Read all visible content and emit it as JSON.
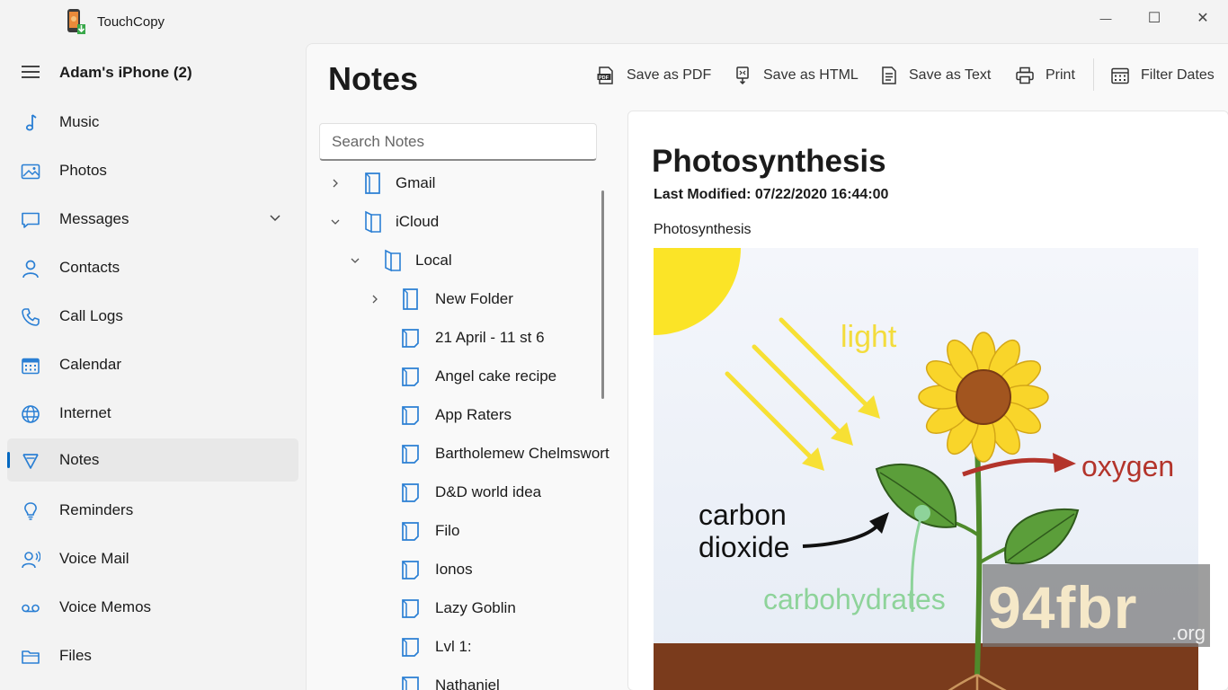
{
  "app": {
    "title": "TouchCopy"
  },
  "window_controls": {
    "minimize": "—",
    "maximize": "☐",
    "close": "✕"
  },
  "sidebar": {
    "device_name": "Adam's iPhone (2)",
    "items": [
      {
        "label": "Music",
        "icon": "music-note-icon"
      },
      {
        "label": "Photos",
        "icon": "photo-icon"
      },
      {
        "label": "Messages",
        "icon": "message-icon",
        "expandable": true
      },
      {
        "label": "Contacts",
        "icon": "contact-icon"
      },
      {
        "label": "Call Logs",
        "icon": "phone-icon"
      },
      {
        "label": "Calendar",
        "icon": "calendar-icon"
      },
      {
        "label": "Internet",
        "icon": "globe-icon"
      },
      {
        "label": "Notes",
        "icon": "notes-icon",
        "active": true
      },
      {
        "label": "Reminders",
        "icon": "bulb-icon"
      },
      {
        "label": "Voice Mail",
        "icon": "voicemail-person-icon"
      },
      {
        "label": "Voice Memos",
        "icon": "voicemail-icon"
      },
      {
        "label": "Files",
        "icon": "folder-icon"
      }
    ]
  },
  "main": {
    "title": "Notes",
    "toolbar": {
      "save_pdf": "Save as PDF",
      "save_html": "Save as HTML",
      "save_text": "Save as Text",
      "print": "Print",
      "filter_dates": "Filter Dates"
    },
    "search": {
      "placeholder": "Search Notes",
      "value": ""
    },
    "tree": [
      {
        "label": "Gmail",
        "level": 0,
        "chevron": "collapsed",
        "type": "folder"
      },
      {
        "label": "iCloud",
        "level": 0,
        "chevron": "expanded",
        "type": "folder-open"
      },
      {
        "label": "Local",
        "level": 1,
        "chevron": "expanded",
        "type": "folder-open"
      },
      {
        "label": "New Folder",
        "level": 2,
        "chevron": "collapsed",
        "type": "folder"
      },
      {
        "label": "21 April - 11 st 6",
        "level": 2,
        "type": "note"
      },
      {
        "label": "Angel cake recipe",
        "level": 2,
        "type": "note"
      },
      {
        "label": "App Raters",
        "level": 2,
        "type": "note"
      },
      {
        "label": "Bartholemew Chelmsworth",
        "level": 2,
        "type": "note"
      },
      {
        "label": "D&D world idea",
        "level": 2,
        "type": "note"
      },
      {
        "label": "Filo",
        "level": 2,
        "type": "note"
      },
      {
        "label": "Ionos",
        "level": 2,
        "type": "note"
      },
      {
        "label": "Lazy Goblin",
        "level": 2,
        "type": "note"
      },
      {
        "label": "Lvl 1:",
        "level": 2,
        "type": "note"
      },
      {
        "label": "Nathaniel",
        "level": 2,
        "type": "note"
      }
    ],
    "note": {
      "title": "Photosynthesis",
      "last_modified": "Last Modified: 07/22/2020 16:44:00",
      "body_text": "Photosynthesis",
      "image_labels": {
        "light": "light",
        "oxygen": "oxygen",
        "carbon_dioxide_line1": "carbon",
        "carbon_dioxide_line2": "dioxide",
        "carbohydrates": "carbohydrates"
      }
    }
  },
  "watermark": {
    "main": "94fbr",
    "suffix": ".org"
  },
  "colors": {
    "accent": "#0067c0",
    "icon_blue": "#2a7fd4",
    "sun": "#fbe427",
    "soil": "#7a3b1c",
    "oxygen": "#b3342b",
    "carbohydrates": "#8ed39a"
  }
}
